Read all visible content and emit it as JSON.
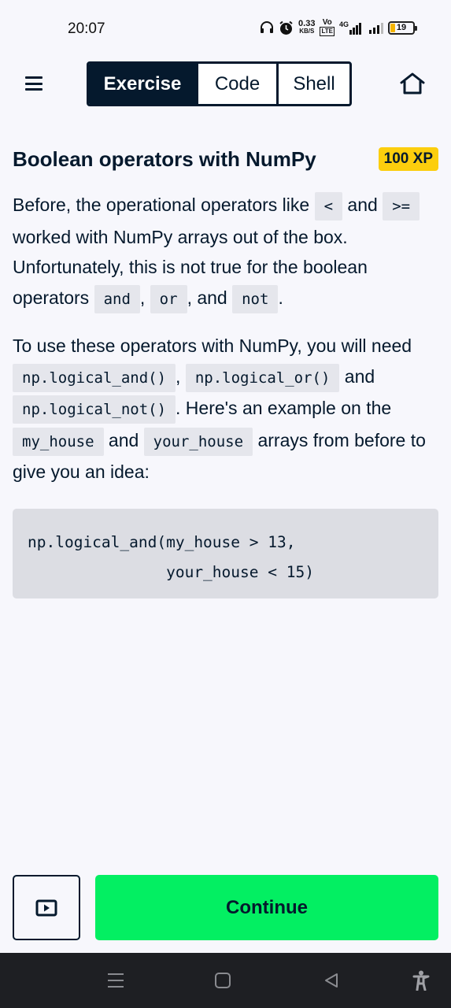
{
  "status_bar": {
    "time": "20:07",
    "net_speed_value": "0.33",
    "net_speed_unit": "KB/S",
    "volte_top": "Vo",
    "volte_bottom": "LTE",
    "network_type": "4G",
    "battery_level": "19",
    "icons": [
      "headphones-icon",
      "alarm-icon",
      "signal-icon",
      "battery-icon"
    ]
  },
  "header": {
    "tabs": [
      {
        "label": "Exercise",
        "active": true
      },
      {
        "label": "Code",
        "active": false
      },
      {
        "label": "Shell",
        "active": false
      }
    ],
    "icons": [
      "menu-icon",
      "home-icon"
    ]
  },
  "exercise": {
    "title": "Boolean operators with NumPy",
    "xp": "100 XP",
    "paragraph1": {
      "t1": "Before, the operational operators like ",
      "c1": "<",
      "t2": " and ",
      "c2": ">=",
      "t3": " worked with NumPy arrays out of the box. Unfortunately, this is not true for the boolean operators ",
      "c3": "and",
      "t4": ", ",
      "c4": "or",
      "t5": ", and ",
      "c5": "not",
      "t6": "."
    },
    "paragraph2": {
      "t1": "To use these operators with NumPy, you will need ",
      "c1": "np.logical_and()",
      "t2": ", ",
      "c2": "np.logical_or()",
      "t3": " and ",
      "c3": "np.logical_not()",
      "t4": ". Here's an example on the ",
      "c4": "my_house",
      "t5": " and ",
      "c5": "your_house",
      "t6": " arrays from before to give you an idea:"
    },
    "code_block": "np.logical_and(my_house > 13,\n               your_house < 15)"
  },
  "footer": {
    "continue_label": "Continue",
    "video_icon": "video-play-icon"
  },
  "nav_bar": {
    "icons": [
      "recents-icon",
      "home-square-icon",
      "back-icon",
      "accessibility-icon"
    ]
  },
  "colors": {
    "brand_navy": "#05192d",
    "accent_green": "#03ef62",
    "xp_yellow": "#fcce0d",
    "background": "#f7f7fc",
    "code_background": "#dcdde3"
  }
}
